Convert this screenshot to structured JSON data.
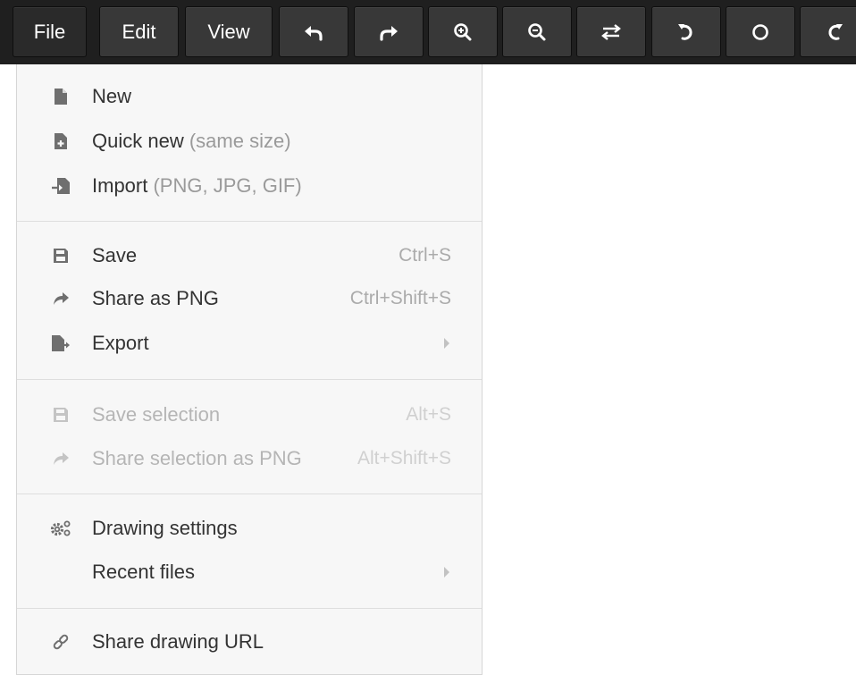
{
  "toolbar": {
    "file_label": "File",
    "edit_label": "Edit",
    "view_label": "View"
  },
  "file_menu": {
    "new": "New",
    "quick_new": "Quick new",
    "quick_new_hint": " (same size)",
    "import": "Import",
    "import_hint": " (PNG, JPG, GIF)",
    "save": "Save",
    "save_shortcut": "Ctrl+S",
    "share_png": "Share as PNG",
    "share_png_shortcut": "Ctrl+Shift+S",
    "export": "Export",
    "save_selection": "Save selection",
    "save_selection_shortcut": "Alt+S",
    "share_selection": "Share selection as PNG",
    "share_selection_shortcut": "Alt+Shift+S",
    "drawing_settings": "Drawing settings",
    "recent_files": "Recent files",
    "share_url": "Share drawing URL"
  }
}
